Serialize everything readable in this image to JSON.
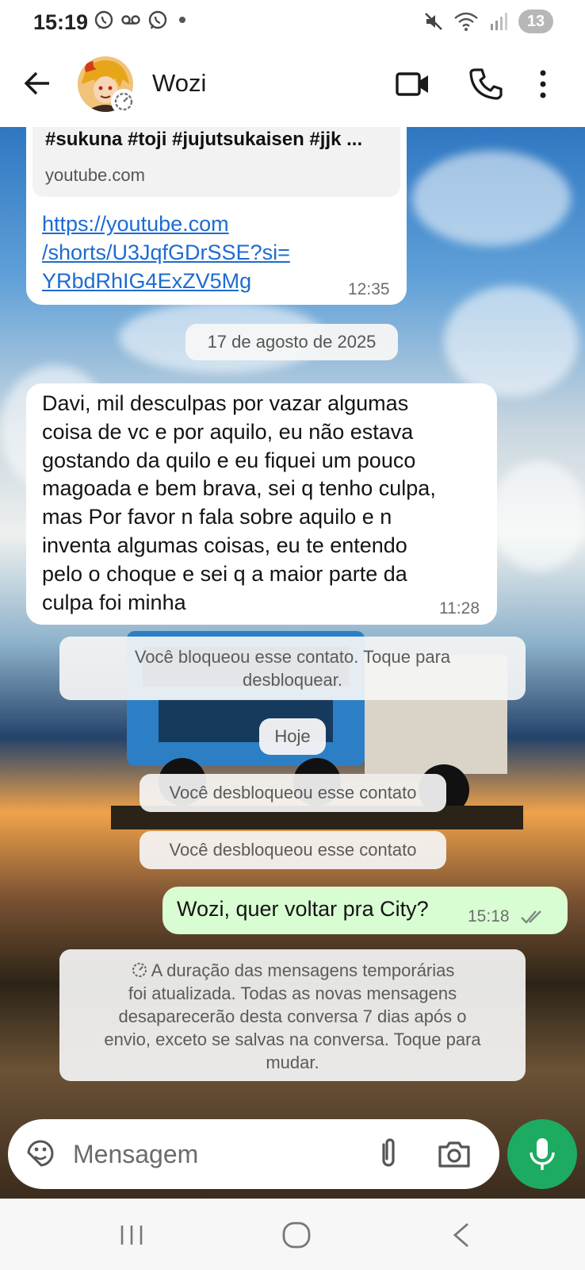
{
  "status_bar": {
    "time": "15:19",
    "battery": "13",
    "left_icons": [
      "whatsapp-status-icon",
      "voicemail-icon",
      "whatsapp-icon",
      "dot-icon"
    ],
    "right_icons": [
      "mute-icon",
      "wifi-icon",
      "signal-icon",
      "battery-icon"
    ]
  },
  "header": {
    "contact_name": "Wozi",
    "actions": [
      "video-call-icon",
      "voice-call-icon",
      "more-options-icon"
    ]
  },
  "messages": {
    "link_message": {
      "preview_title": "#sukuna #toji #jujutsukaisen #jjk ...",
      "preview_domain": "youtube.com",
      "link_line1": "https://youtube.com",
      "link_line2": "/shorts/U3JqfGDrSSE?si=",
      "link_line3": "YRbdRhIG4ExZV5Mg",
      "time": "12:35"
    },
    "date_chip_1": "17 de agosto de 2025",
    "incoming_long": {
      "lines": [
        "Davi, mil desculpas por vazar algumas",
        "coisa de vc e por aquilo, eu não estava",
        "gostando da quilo e eu fiquei um pouco",
        "magoada e bem brava, sei q tenho culpa,",
        "mas Por favor n fala sobre aquilo e n",
        "inventa algumas coisas, eu te entendo",
        "pelo o choque e sei q a maior parte da",
        "culpa foi minha"
      ],
      "time": "11:28"
    },
    "system_blocked": {
      "line1": "Você bloqueou esse contato. Toque para",
      "line2": "desbloquear."
    },
    "date_chip_2": "Hoje",
    "system_unblocked_1": "Você desbloqueou esse contato",
    "system_unblocked_2": "Você desbloqueou esse contato",
    "outgoing": {
      "text": "Wozi, quer voltar pra City?",
      "time": "15:18"
    },
    "system_disappearing": {
      "line1": "A duração das mensagens temporárias",
      "line2": "foi atualizada. Todas as novas mensagens",
      "line3": "desaparecerão desta conversa 7 dias após o",
      "line4": "envio, exceto se salvas na conversa. Toque para",
      "line5": "mudar."
    }
  },
  "composer": {
    "placeholder": "Mensagem"
  },
  "colors": {
    "accent_green": "#1daa61",
    "outgoing_bubble": "#d9fdd3",
    "link": "#1d6bd1"
  }
}
